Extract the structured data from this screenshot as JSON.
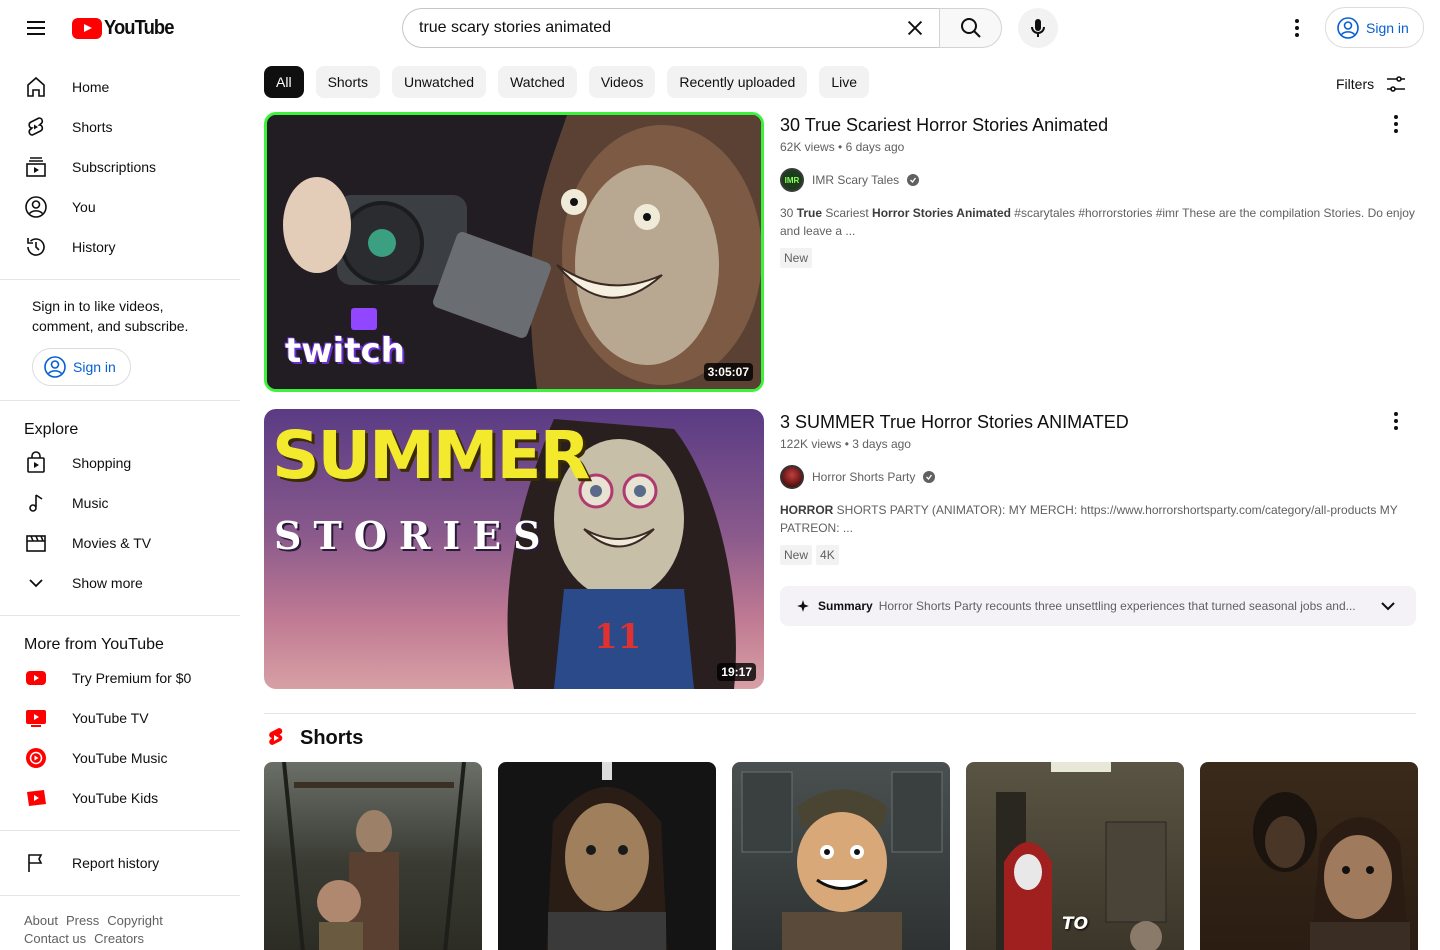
{
  "header": {
    "logo_text": "YouTube",
    "search_value": "true scary stories animated",
    "signin_label": "Sign in"
  },
  "sidebar": {
    "main": [
      {
        "label": "Home",
        "icon": "home-icon"
      },
      {
        "label": "Shorts",
        "icon": "shorts-icon"
      },
      {
        "label": "Subscriptions",
        "icon": "subscriptions-icon"
      },
      {
        "label": "You",
        "icon": "you-icon"
      },
      {
        "label": "History",
        "icon": "history-icon"
      }
    ],
    "signin_prompt": "Sign in to like videos, comment, and subscribe.",
    "signin_label": "Sign in",
    "explore_title": "Explore",
    "explore": [
      {
        "label": "Shopping",
        "icon": "shopping-icon"
      },
      {
        "label": "Music",
        "icon": "music-icon"
      },
      {
        "label": "Movies & TV",
        "icon": "movies-icon"
      },
      {
        "label": "Show more",
        "icon": "chevron-down-icon"
      }
    ],
    "more_title": "More from YouTube",
    "more": [
      {
        "label": "Try Premium for $0",
        "icon": "youtube-premium-icon"
      },
      {
        "label": "YouTube TV",
        "icon": "youtube-tv-icon"
      },
      {
        "label": "YouTube Music",
        "icon": "youtube-music-icon"
      },
      {
        "label": "YouTube Kids",
        "icon": "youtube-kids-icon"
      }
    ],
    "report_history": "Report history",
    "footer": [
      "About",
      "Press",
      "Copyright",
      "Contact us",
      "Creators"
    ]
  },
  "chips": [
    "All",
    "Shorts",
    "Unwatched",
    "Watched",
    "Videos",
    "Recently uploaded",
    "Live"
  ],
  "filters_label": "Filters",
  "videos": [
    {
      "title": "30 True Scariest Horror Stories Animated",
      "views": "62K views",
      "age": "6 days ago",
      "channel": "IMR Scary Tales",
      "desc_pre": "30 ",
      "desc_b1": "True",
      "desc_mid": " Scariest ",
      "desc_b2": "Horror Stories Animated",
      "desc_post": " #scarytales #horrorstories #imr These are the compilation Stories. Do enjoy and leave a ...",
      "badges": [
        "New"
      ],
      "duration": "3:05:07",
      "thumb_text": "twitch"
    },
    {
      "title": "3 SUMMER True Horror Stories ANIMATED",
      "views": "122K views",
      "age": "3 days ago",
      "channel": "Horror Shorts Party",
      "desc_b1": "HORROR",
      "desc_post": " SHORTS PARTY (ANIMATOR): MY MERCH: https://www.horrorshortsparty.com/category/all-products MY PATREON: ...",
      "badges": [
        "New",
        "4K"
      ],
      "duration": "19:17",
      "thumb_text1": "SUMMER",
      "thumb_text2": "STORIES",
      "summary_label": "Summary",
      "summary_text": "Horror Shorts Party recounts three unsettling experiences that turned seasonal jobs and..."
    }
  ],
  "shorts": {
    "title": "Shorts",
    "items": [
      {
        "overlay": ""
      },
      {
        "overlay": ""
      },
      {
        "overlay": ""
      },
      {
        "overlay": "TO"
      },
      {
        "overlay": ""
      }
    ]
  }
}
